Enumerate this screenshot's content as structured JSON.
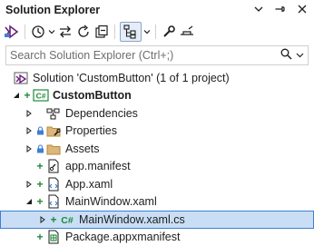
{
  "window": {
    "title": "Solution Explorer"
  },
  "search": {
    "placeholder": "Search Solution Explorer (Ctrl+;)"
  },
  "tree": {
    "solution": "Solution 'CustomButton' (1 of 1 project)",
    "project": "CustomButton",
    "items": [
      {
        "label": "Dependencies"
      },
      {
        "label": "Properties"
      },
      {
        "label": "Assets"
      },
      {
        "label": "app.manifest"
      },
      {
        "label": "App.xaml"
      },
      {
        "label": "MainWindow.xaml"
      },
      {
        "label": "MainWindow.xaml.cs"
      },
      {
        "label": "Package.appxmanifest"
      }
    ]
  },
  "colors": {
    "accent": "#3f7fd1",
    "selection": "#c9def5",
    "added": "#1e8a38",
    "project": "#68217a"
  }
}
